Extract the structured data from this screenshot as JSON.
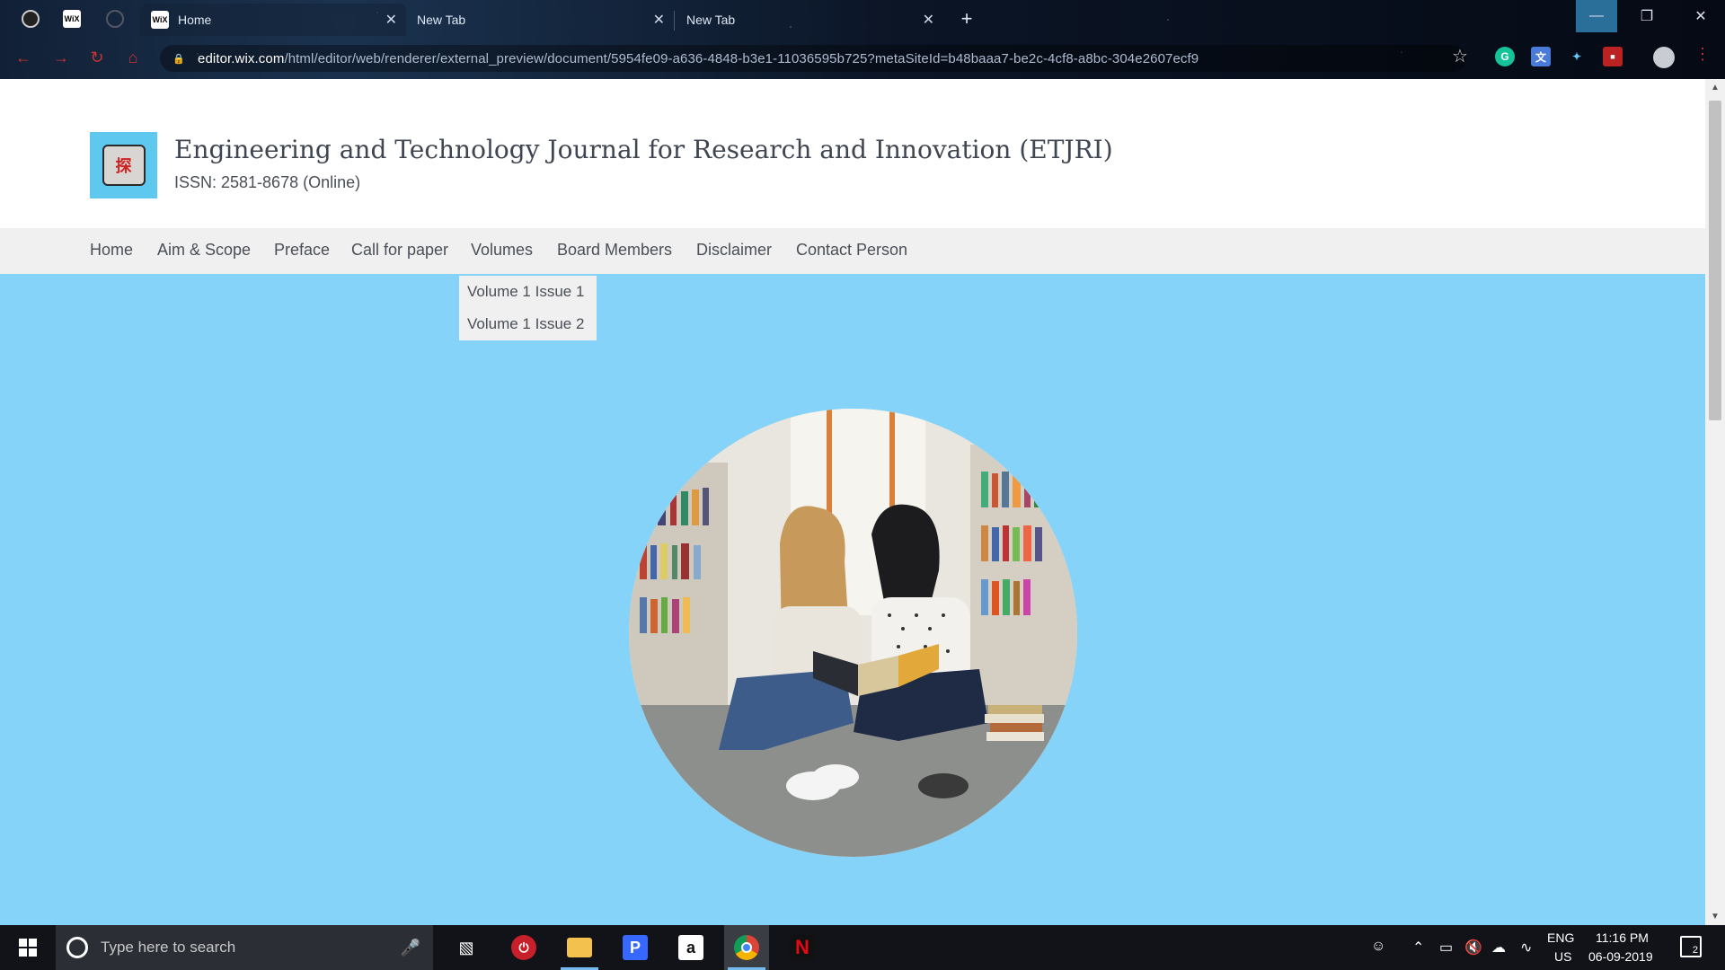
{
  "browser": {
    "tabs": [
      {
        "label": "Home",
        "favicon": "wix-icon",
        "active": true
      },
      {
        "label": "New Tab",
        "favicon": "",
        "active": false
      },
      {
        "label": "New Tab",
        "favicon": "",
        "active": false
      }
    ],
    "pinned_tabs": [
      "github-icon",
      "wix-icon",
      "circle-icon"
    ],
    "url_host": "editor.wix.com",
    "url_path": "/html/editor/web/renderer/external_preview/document/5954fe09-a636-4848-b3e1-11036595b725?metaSiteId=b48baaa7-be2c-4cf8-a8bc-304e2607ecf9",
    "new_tab_symbol": "+",
    "close_symbol": "✕"
  },
  "site": {
    "title": "Engineering and Technology Journal for Research and Innovation (ETJRI)",
    "issn": "ISSN: 2581-8678 (Online)",
    "logo_glyph": "探",
    "nav": [
      {
        "label": "Home"
      },
      {
        "label": "Aim & Scope"
      },
      {
        "label": "Preface"
      },
      {
        "label": "Call for paper"
      },
      {
        "label": "Volumes"
      },
      {
        "label": "Board Members"
      },
      {
        "label": "Disclaimer"
      },
      {
        "label": "Contact Person"
      }
    ],
    "volumes_dropdown": [
      {
        "label": "Volume 1 Issue 1"
      },
      {
        "label": "Volume 1 Issue 2"
      }
    ],
    "colors": {
      "hero_bg": "#86d3f9",
      "nav_bg": "#f0f0f0",
      "logo_bg": "#5ec8ef"
    }
  },
  "taskbar": {
    "search_placeholder": "Type here to search",
    "language": "ENG",
    "region": "US",
    "time": "11:16 PM",
    "date": "06-09-2019",
    "notification_count": "2",
    "apps": [
      "task-view-icon",
      "power-app-icon",
      "file-explorer-icon",
      "pandora-icon",
      "amazon-icon",
      "chrome-icon",
      "netflix-icon"
    ]
  }
}
